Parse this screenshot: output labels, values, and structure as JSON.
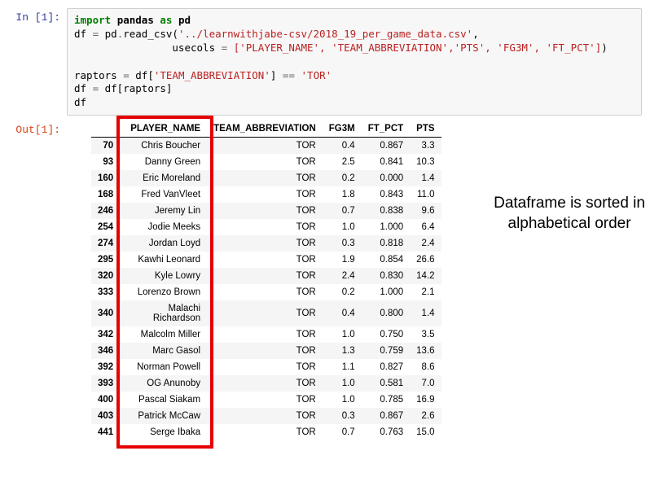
{
  "input_prompt": "In [1]:",
  "output_prompt": "Out[1]:",
  "code": {
    "line1_import": "import",
    "line1_pandas": "pandas",
    "line1_as": "as",
    "line1_pd": "pd",
    "csv_path": "'../learnwithjabe-csv/2018_19_per_game_data.csv'",
    "usecols_list": "['PLAYER_NAME', 'TEAM_ABBREVIATION','PTS', 'FG3M', 'FT_PCT']",
    "col_team": "'TEAM_ABBREVIATION'",
    "tor": "'TOR'"
  },
  "table": {
    "headers": [
      "PLAYER_NAME",
      "TEAM_ABBREVIATION",
      "FG3M",
      "FT_PCT",
      "PTS"
    ],
    "rows": [
      {
        "idx": "70",
        "name": "Chris Boucher",
        "team": "TOR",
        "fg3m": "0.4",
        "ftpct": "0.867",
        "pts": "3.3"
      },
      {
        "idx": "93",
        "name": "Danny Green",
        "team": "TOR",
        "fg3m": "2.5",
        "ftpct": "0.841",
        "pts": "10.3"
      },
      {
        "idx": "160",
        "name": "Eric Moreland",
        "team": "TOR",
        "fg3m": "0.2",
        "ftpct": "0.000",
        "pts": "1.4"
      },
      {
        "idx": "168",
        "name": "Fred VanVleet",
        "team": "TOR",
        "fg3m": "1.8",
        "ftpct": "0.843",
        "pts": "11.0"
      },
      {
        "idx": "246",
        "name": "Jeremy Lin",
        "team": "TOR",
        "fg3m": "0.7",
        "ftpct": "0.838",
        "pts": "9.6"
      },
      {
        "idx": "254",
        "name": "Jodie Meeks",
        "team": "TOR",
        "fg3m": "1.0",
        "ftpct": "1.000",
        "pts": "6.4"
      },
      {
        "idx": "274",
        "name": "Jordan Loyd",
        "team": "TOR",
        "fg3m": "0.3",
        "ftpct": "0.818",
        "pts": "2.4"
      },
      {
        "idx": "295",
        "name": "Kawhi Leonard",
        "team": "TOR",
        "fg3m": "1.9",
        "ftpct": "0.854",
        "pts": "26.6"
      },
      {
        "idx": "320",
        "name": "Kyle Lowry",
        "team": "TOR",
        "fg3m": "2.4",
        "ftpct": "0.830",
        "pts": "14.2"
      },
      {
        "idx": "333",
        "name": "Lorenzo Brown",
        "team": "TOR",
        "fg3m": "0.2",
        "ftpct": "1.000",
        "pts": "2.1"
      },
      {
        "idx": "340",
        "name": "Malachi Richardson",
        "team": "TOR",
        "fg3m": "0.4",
        "ftpct": "0.800",
        "pts": "1.4"
      },
      {
        "idx": "342",
        "name": "Malcolm Miller",
        "team": "TOR",
        "fg3m": "1.0",
        "ftpct": "0.750",
        "pts": "3.5"
      },
      {
        "idx": "346",
        "name": "Marc Gasol",
        "team": "TOR",
        "fg3m": "1.3",
        "ftpct": "0.759",
        "pts": "13.6"
      },
      {
        "idx": "392",
        "name": "Norman Powell",
        "team": "TOR",
        "fg3m": "1.1",
        "ftpct": "0.827",
        "pts": "8.6"
      },
      {
        "idx": "393",
        "name": "OG Anunoby",
        "team": "TOR",
        "fg3m": "1.0",
        "ftpct": "0.581",
        "pts": "7.0"
      },
      {
        "idx": "400",
        "name": "Pascal Siakam",
        "team": "TOR",
        "fg3m": "1.0",
        "ftpct": "0.785",
        "pts": "16.9"
      },
      {
        "idx": "403",
        "name": "Patrick McCaw",
        "team": "TOR",
        "fg3m": "0.3",
        "ftpct": "0.867",
        "pts": "2.6"
      },
      {
        "idx": "441",
        "name": "Serge Ibaka",
        "team": "TOR",
        "fg3m": "0.7",
        "ftpct": "0.763",
        "pts": "15.0"
      }
    ]
  },
  "annotation": {
    "line1": "Dataframe is sorted in",
    "line2": "alphabetical order"
  }
}
